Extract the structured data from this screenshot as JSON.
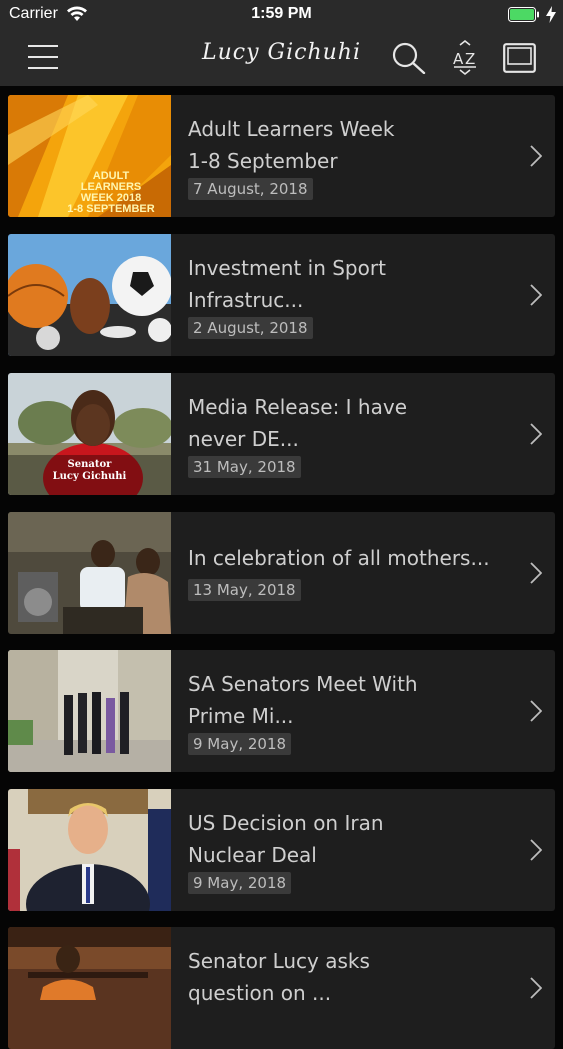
{
  "status_bar": {
    "carrier": "Carrier",
    "time": "1:59 PM",
    "battery_color": "#4cd964"
  },
  "nav": {
    "title": "Lucy Gichuhi",
    "icons": [
      "menu-icon",
      "search-icon",
      "sort-az-icon",
      "tablet-view-icon"
    ]
  },
  "colors": {
    "background": "#050505",
    "bar": "#2a2a2a",
    "card": "#1e1e1e",
    "date_badge": "#3a3a3a"
  },
  "articles": [
    {
      "headline": "Adult Learners Week\n1-8 September",
      "date": "7 August, 2018",
      "thumb_caption": "ADULT\nLEARNERS\nWEEK 2018\n1-8 SEPTEMBER"
    },
    {
      "headline": "Investment in Sport\nInfrastruc...",
      "date": "2 August, 2018"
    },
    {
      "headline": "Media Release: I have\nnever DE...",
      "date": "31 May, 2018",
      "thumb_caption": "Senator\nLucy Gichuhi"
    },
    {
      "headline": " In celebration of all mothers...",
      "date": "13 May, 2018"
    },
    {
      "headline": "SA Senators Meet With\nPrime Mi...",
      "date": "9 May, 2018"
    },
    {
      "headline": "US Decision on Iran\nNuclear Deal",
      "date": "9 May, 2018"
    },
    {
      "headline": "Senator Lucy asks\nquestion on ...",
      "date": ""
    }
  ]
}
